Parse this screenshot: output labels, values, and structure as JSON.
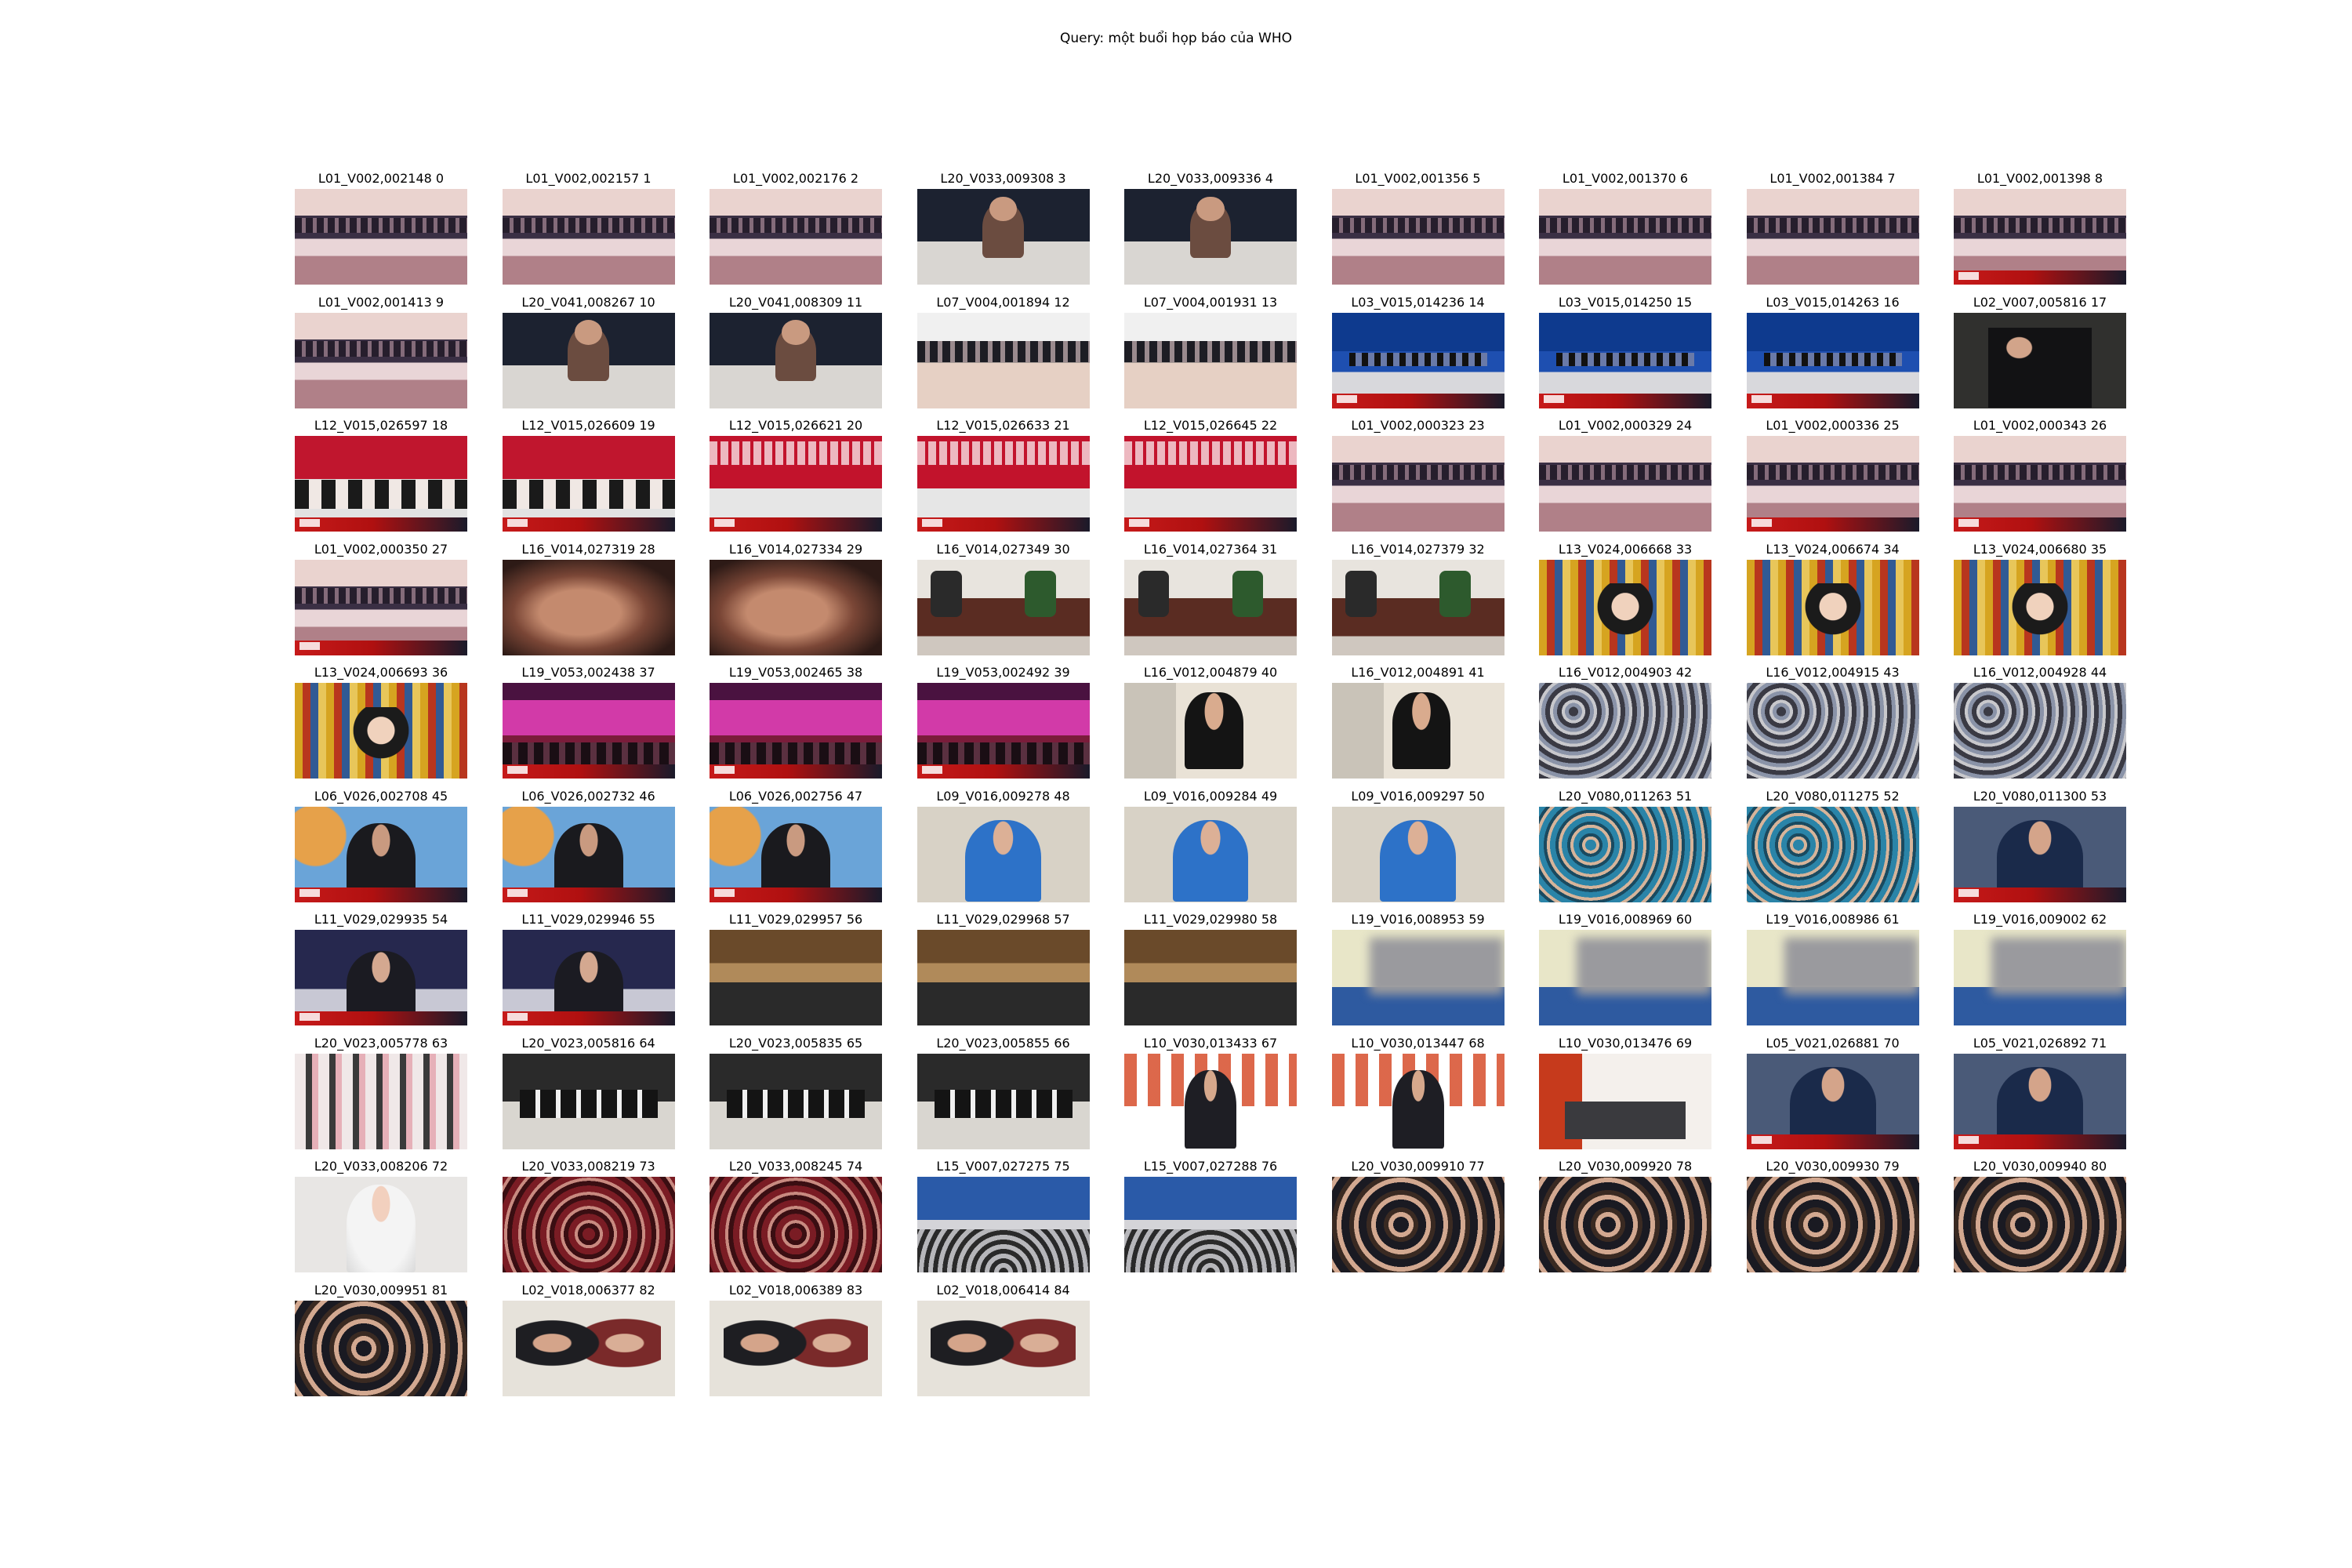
{
  "query": "Query: một buổi họp báo của WHO",
  "items": [
    {
      "label": "L01_V002,002148 0",
      "style": "pink"
    },
    {
      "label": "L01_V002,002157 1",
      "style": "pink"
    },
    {
      "label": "L01_V002,002176 2",
      "style": "pink"
    },
    {
      "label": "L20_V033,009308 3",
      "style": "speaker"
    },
    {
      "label": "L20_V033,009336 4",
      "style": "speaker"
    },
    {
      "label": "L01_V002,001356 5",
      "style": "pink"
    },
    {
      "label": "L01_V002,001370 6",
      "style": "pink"
    },
    {
      "label": "L01_V002,001384 7",
      "style": "pink"
    },
    {
      "label": "L01_V002,001398 8",
      "style": "pink-banner"
    },
    {
      "label": "L01_V002,001413 9",
      "style": "pink"
    },
    {
      "label": "L20_V041,008267 10",
      "style": "speaker"
    },
    {
      "label": "L20_V041,008309 11",
      "style": "speaker"
    },
    {
      "label": "L07_V004,001894 12",
      "style": "conf"
    },
    {
      "label": "L07_V004,001931 13",
      "style": "conf"
    },
    {
      "label": "L03_V015,014236 14",
      "style": "blue-banner"
    },
    {
      "label": "L03_V015,014250 15",
      "style": "blue-banner"
    },
    {
      "label": "L03_V015,014263 16",
      "style": "blue-banner"
    },
    {
      "label": "L02_V007,005816 17",
      "style": "suit"
    },
    {
      "label": "L12_V015,026597 18",
      "style": "red"
    },
    {
      "label": "L12_V015,026609 19",
      "style": "red"
    },
    {
      "label": "L12_V015,026621 20",
      "style": "bigthai"
    },
    {
      "label": "L12_V015,026633 21",
      "style": "bigthai"
    },
    {
      "label": "L12_V015,026645 22",
      "style": "bigthai"
    },
    {
      "label": "L01_V002,000323 23",
      "style": "pink"
    },
    {
      "label": "L01_V002,000329 24",
      "style": "pink"
    },
    {
      "label": "L01_V002,000336 25",
      "style": "pink-banner"
    },
    {
      "label": "L01_V002,000343 26",
      "style": "pink-banner"
    },
    {
      "label": "L01_V002,000350 27",
      "style": "pink-banner"
    },
    {
      "label": "L16_V014,027319 28",
      "style": "hands"
    },
    {
      "label": "L16_V014,027334 29",
      "style": "hands"
    },
    {
      "label": "L16_V014,027349 30",
      "style": "table"
    },
    {
      "label": "L16_V014,027364 31",
      "style": "table"
    },
    {
      "label": "L16_V014,027379 32",
      "style": "table"
    },
    {
      "label": "L13_V024,006668 33",
      "style": "books"
    },
    {
      "label": "L13_V024,006674 34",
      "style": "books"
    },
    {
      "label": "L13_V024,006680 35",
      "style": "books"
    },
    {
      "label": "L13_V024,006693 36",
      "style": "books"
    },
    {
      "label": "L19_V053,002438 37",
      "style": "stage"
    },
    {
      "label": "L19_V053,002465 38",
      "style": "stage"
    },
    {
      "label": "L19_V053,002492 39",
      "style": "stage"
    },
    {
      "label": "L16_V012,004879 40",
      "style": "mic"
    },
    {
      "label": "L16_V012,004891 41",
      "style": "mic"
    },
    {
      "label": "L16_V012,004903 42",
      "style": "crowd"
    },
    {
      "label": "L16_V012,004915 43",
      "style": "crowd"
    },
    {
      "label": "L16_V012,004928 44",
      "style": "crowd"
    },
    {
      "label": "L06_V026,002708 45",
      "style": "who"
    },
    {
      "label": "L06_V026,002732 46",
      "style": "who"
    },
    {
      "label": "L06_V026,002756 47",
      "style": "who"
    },
    {
      "label": "L09_V016,009278 48",
      "style": "guy"
    },
    {
      "label": "L09_V016,009284 49",
      "style": "guy"
    },
    {
      "label": "L09_V016,009297 50",
      "style": "guy"
    },
    {
      "label": "L20_V080,011263 51",
      "style": "teal"
    },
    {
      "label": "L20_V080,011275 52",
      "style": "teal"
    },
    {
      "label": "L20_V080,011300 53",
      "style": "blueguy"
    },
    {
      "label": "L11_V029,029935 54",
      "style": "sweden"
    },
    {
      "label": "L11_V029,029946 55",
      "style": "sweden"
    },
    {
      "label": "L11_V029,029957 56",
      "style": "hall"
    },
    {
      "label": "L11_V029,029968 57",
      "style": "hall"
    },
    {
      "label": "L11_V029,029980 58",
      "style": "hall"
    },
    {
      "label": "L19_V016,008953 59",
      "style": "blur"
    },
    {
      "label": "L19_V016,008969 60",
      "style": "blur"
    },
    {
      "label": "L19_V016,008986 61",
      "style": "blur"
    },
    {
      "label": "L19_V016,009002 62",
      "style": "blur"
    },
    {
      "label": "L20_V023,005778 63",
      "style": "fans"
    },
    {
      "label": "L20_V023,005816 64",
      "style": "dark"
    },
    {
      "label": "L20_V023,005835 65",
      "style": "dark"
    },
    {
      "label": "L20_V023,005855 66",
      "style": "dark"
    },
    {
      "label": "L10_V030,013433 67",
      "style": "jp"
    },
    {
      "label": "L10_V030,013447 68",
      "style": "jp"
    },
    {
      "label": "L10_V030,013476 69",
      "style": "jproom"
    },
    {
      "label": "L05_V021,026881 70",
      "style": "blueguy"
    },
    {
      "label": "L05_V021,026892 71",
      "style": "blueguy"
    },
    {
      "label": "L20_V033,008206 72",
      "style": "woman"
    },
    {
      "label": "L20_V033,008219 73",
      "style": "redaud"
    },
    {
      "label": "L20_V033,008245 74",
      "style": "redaud"
    },
    {
      "label": "L15_V007,027275 75",
      "style": "tedpanel"
    },
    {
      "label": "L15_V007,027288 76",
      "style": "tedpanel"
    },
    {
      "label": "L20_V030,009910 77",
      "style": "vip"
    },
    {
      "label": "L20_V030,009920 78",
      "style": "vip"
    },
    {
      "label": "L20_V030,009930 79",
      "style": "vip"
    },
    {
      "label": "L20_V030,009940 80",
      "style": "vip"
    },
    {
      "label": "L20_V030,009951 81",
      "style": "vip"
    },
    {
      "label": "L02_V018,006377 82",
      "style": "elder"
    },
    {
      "label": "L02_V018,006389 83",
      "style": "elder"
    },
    {
      "label": "L02_V018,006414 84",
      "style": "elder"
    }
  ]
}
